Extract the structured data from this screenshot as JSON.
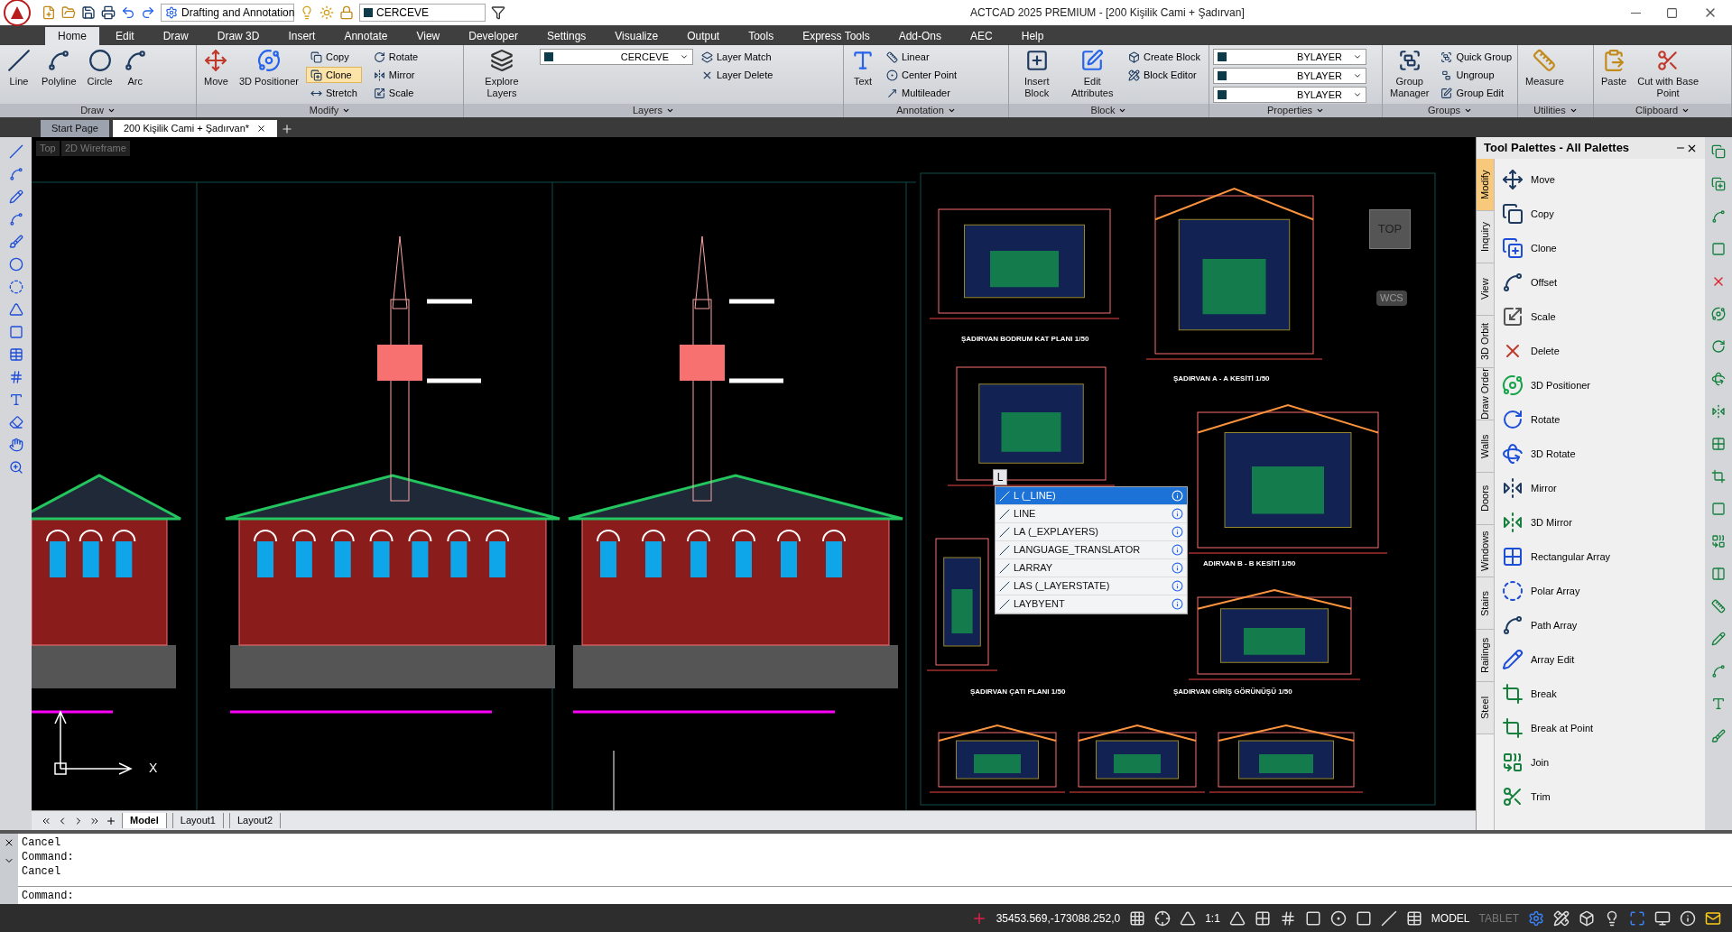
{
  "app": {
    "title": "ACTCAD 2025 PREMIUM - [200 Kişilik Cami + Şadırvan]",
    "workspace": "Drafting and Annotation",
    "layer": "CERCEVE"
  },
  "ribbon_tabs": [
    {
      "label": "Home",
      "selected": true
    },
    {
      "label": "Edit",
      "selected": false
    },
    {
      "label": "Draw",
      "selected": false
    },
    {
      "label": "Draw 3D",
      "selected": false
    },
    {
      "label": "Insert",
      "selected": false
    },
    {
      "label": "Annotate",
      "selected": false
    },
    {
      "label": "View",
      "selected": false
    },
    {
      "label": "Developer",
      "selected": false
    },
    {
      "label": "Settings",
      "selected": false
    },
    {
      "label": "Visualize",
      "selected": false
    },
    {
      "label": "Output",
      "selected": false
    },
    {
      "label": "Tools",
      "selected": false
    },
    {
      "label": "Express Tools",
      "selected": false
    },
    {
      "label": "Add-Ons",
      "selected": false
    },
    {
      "label": "AEC",
      "selected": false
    },
    {
      "label": "Help",
      "selected": false
    }
  ],
  "ribbon_panels": [
    {
      "title": "Draw",
      "large": [
        {
          "label": "Line"
        },
        {
          "label": "Polyline"
        },
        {
          "label": "Circle"
        },
        {
          "label": "Arc"
        }
      ]
    },
    {
      "title": "Modify",
      "large": [
        {
          "label": "Move"
        },
        {
          "label": "3D Positioner"
        }
      ],
      "small": [
        {
          "label": "Copy",
          "active": false
        },
        {
          "label": "Clone",
          "active": true
        },
        {
          "label": "Stretch",
          "active": false
        },
        {
          "label": "Rotate",
          "active": false
        },
        {
          "label": "Mirror",
          "active": false
        },
        {
          "label": "Scale",
          "active": false
        }
      ]
    },
    {
      "title": "Layers",
      "large": [
        {
          "label": "Explore Layers"
        }
      ],
      "dropdowns": [
        {
          "value": "CERCEVE"
        }
      ],
      "small": [
        {
          "label": "Layer Match",
          "active": false
        },
        {
          "label": "Layer Delete",
          "active": false
        }
      ]
    },
    {
      "title": "Annotation",
      "large": [
        {
          "label": "Text"
        }
      ],
      "small": [
        {
          "label": "Linear",
          "active": false
        },
        {
          "label": "Center Point",
          "active": false
        },
        {
          "label": "Multileader",
          "active": false
        }
      ]
    },
    {
      "title": "Block",
      "large": [
        {
          "label": "Insert Block"
        },
        {
          "label": "Edit Attributes"
        }
      ],
      "small": [
        {
          "label": "Create Block",
          "active": false
        },
        {
          "label": "Block Editor",
          "active": false
        }
      ]
    },
    {
      "title": "Properties",
      "dropdowns": [
        {
          "value": "BYLAYER"
        },
        {
          "value": "BYLAYER"
        },
        {
          "value": "BYLAYER"
        }
      ]
    },
    {
      "title": "Groups",
      "large": [
        {
          "label": "Group Manager"
        }
      ],
      "small": [
        {
          "label": "Quick Group",
          "active": false
        },
        {
          "label": "Ungroup",
          "active": false
        },
        {
          "label": "Group Edit",
          "active": false
        }
      ]
    },
    {
      "title": "Utilities",
      "large": [
        {
          "label": "Measure"
        }
      ]
    },
    {
      "title": "Clipboard",
      "large": [
        {
          "label": "Paste"
        },
        {
          "label": "Cut with Base Point"
        }
      ]
    }
  ],
  "doc_tabs": [
    {
      "label": "Start Page",
      "selected": false
    },
    {
      "label": "200 Kişilik Cami + Şadırvan*",
      "selected": true
    }
  ],
  "viewport": {
    "view": "Top",
    "style": "2D Wireframe",
    "cube": "TOP",
    "ucs": "WCS",
    "axis": "X"
  },
  "drawing_titles": [
    "ŞADIRVAN BODRUM KAT PLANI 1/50",
    "ŞADIRVAN A - A KESİTİ 1/50",
    "ADIRVAN B - B KESİTİ 1/50",
    "ŞADIRVAN ÇATI PLANI 1/50",
    "ŞADIRVAN GİRİŞ GÖRÜNÜŞÜ 1/50"
  ],
  "autocomplete": {
    "input": "L",
    "items": [
      {
        "label": "L (_LINE)",
        "selected": true
      },
      {
        "label": "LINE",
        "selected": false
      },
      {
        "label": "LA (_EXPLAYERS)",
        "selected": false
      },
      {
        "label": "LANGUAGE_TRANSLATOR",
        "selected": false
      },
      {
        "label": "LARRAY",
        "selected": false
      },
      {
        "label": "LAS (_LAYERSTATE)",
        "selected": false
      },
      {
        "label": "LAYBYENT",
        "selected": false
      }
    ]
  },
  "tool_palette": {
    "title": "Tool Palettes - All Palettes",
    "tabs": [
      {
        "label": "Modify",
        "selected": true
      },
      {
        "label": "Inquiry",
        "selected": false
      },
      {
        "label": "View",
        "selected": false
      },
      {
        "label": "3D Orbit",
        "selected": false
      },
      {
        "label": "Draw Order",
        "selected": false
      },
      {
        "label": "Walls",
        "selected": false
      },
      {
        "label": "Doors",
        "selected": false
      },
      {
        "label": "Windows",
        "selected": false
      },
      {
        "label": "Stairs",
        "selected": false
      },
      {
        "label": "Railings",
        "selected": false
      },
      {
        "label": "Steel",
        "selected": false
      }
    ],
    "items": [
      "Move",
      "Copy",
      "Clone",
      "Offset",
      "Scale",
      "Delete",
      "3D Positioner",
      "Rotate",
      "3D Rotate",
      "Mirror",
      "3D Mirror",
      "Rectangular Array",
      "Polar Array",
      "Path Array",
      "Array Edit",
      "Break",
      "Break at Point",
      "Join",
      "Trim"
    ]
  },
  "layout_tabs": [
    {
      "label": "Model",
      "selected": true
    },
    {
      "label": "Layout1",
      "selected": false
    },
    {
      "label": "Layout2",
      "selected": false
    }
  ],
  "command": {
    "history": [
      "Cancel",
      "Command:",
      "Cancel"
    ],
    "prompt": "Command:"
  },
  "status_bar": {
    "coordinates": "35453.569,-173088.252,0",
    "scale": "1:1",
    "modes": [
      {
        "label": "MODEL",
        "on": true
      },
      {
        "label": "TABLET",
        "on": false
      }
    ]
  }
}
